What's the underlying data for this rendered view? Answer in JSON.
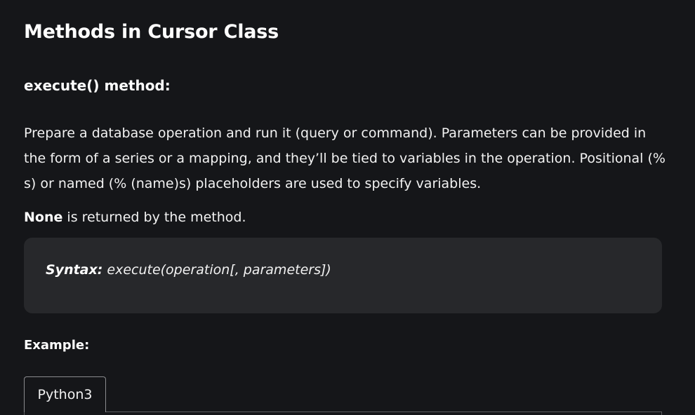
{
  "article": {
    "title": "Methods in Cursor Class",
    "method_heading": "execute() method:",
    "description": "Prepare a database operation and run it (query or command). Parameters can be provided in the form of a series or a mapping, and they’ll be tied to variables in the operation. Positional (% s) or named (% (name)s) placeholders are used to specify variables.",
    "returns_bold": "None",
    "returns_rest": " is returned by the method.",
    "syntax_label": "Syntax:",
    "syntax_value": " execute(operation[, parameters])",
    "example_label": "Example:"
  },
  "code_tabs": [
    {
      "label": "Python3",
      "active": true
    }
  ]
}
